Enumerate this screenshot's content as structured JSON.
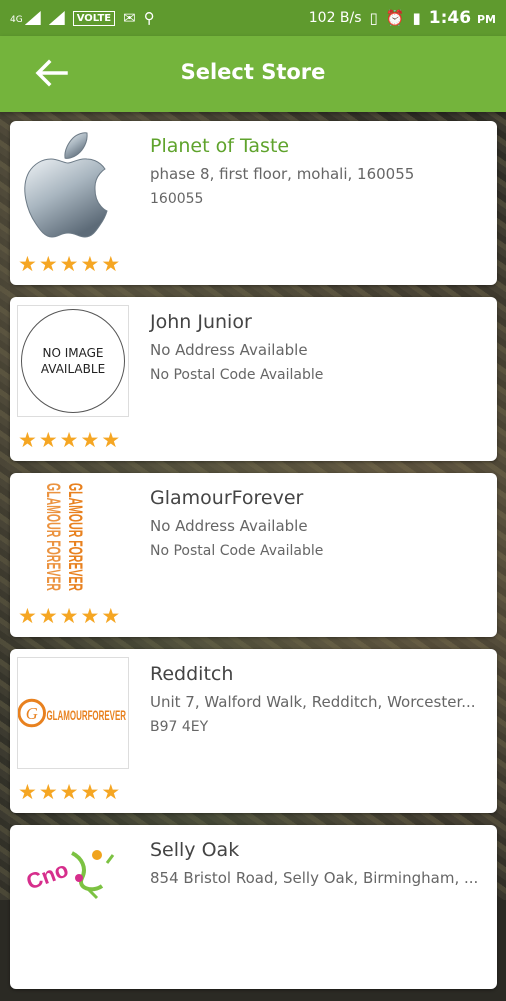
{
  "status_bar": {
    "network": "4G",
    "volte": "VOLTE",
    "speed": "102 B/s",
    "time": "1:46",
    "ampm": "PM"
  },
  "header": {
    "title": "Select Store"
  },
  "colors": {
    "appbar": "#74b43c",
    "statusbar": "#5f9a2e",
    "star": "#f5a623",
    "selected_name": "#5fa32c"
  },
  "stores": [
    {
      "name": "Planet of Taste",
      "address": "phase 8, first floor, mohali, 160055",
      "postal": "160055",
      "rating": 5,
      "logo": "apple-logo-icon"
    },
    {
      "name": "John Junior",
      "address": "No Address Available",
      "postal": "No Postal Code Available",
      "rating": 5,
      "logo": "no-image-placeholder",
      "logo_text": "NO IMAGE AVAILABLE"
    },
    {
      "name": "GlamourForever",
      "address": "No Address Available",
      "postal": "No Postal Code Available",
      "rating": 5,
      "logo": "glamour-forever-logo",
      "logo_text": "GLAMOUR FOREVER"
    },
    {
      "name": "Redditch",
      "address": "Unit 7, Walford Walk, Redditch, Worcester...",
      "postal": "B97 4EY",
      "rating": 5,
      "logo": "glamour-forever-g-logo",
      "logo_text": "GLAMOURFOREVER"
    },
    {
      "name": "Selly Oak",
      "address": "854 Bristol Road, Selly Oak, Birmingham, ...",
      "postal": "",
      "rating": 5,
      "logo": "colorful-logo"
    }
  ]
}
